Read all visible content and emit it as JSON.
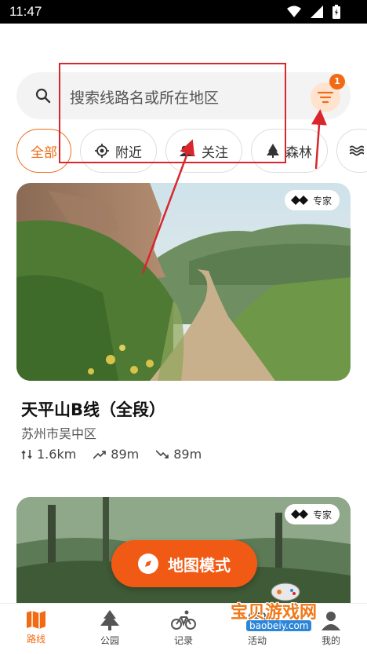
{
  "status": {
    "time": "11:47"
  },
  "search": {
    "placeholder": "搜索线路名或所在地区",
    "filter_badge": "1"
  },
  "chips": [
    {
      "label": "全部",
      "active": true,
      "icon": "none"
    },
    {
      "label": "附近",
      "icon": "location-target-icon"
    },
    {
      "label": "关注",
      "icon": "people-icon"
    },
    {
      "label": "森林",
      "icon": "tree-icon"
    },
    {
      "label": "",
      "icon": "water-waves-icon"
    }
  ],
  "cards": [
    {
      "badge": "专家",
      "title": "天平山B线（全段）",
      "location": "苏州市吴中区",
      "distance": "1.6km",
      "ascent": "89m",
      "descent": "89m"
    },
    {
      "badge": "专家"
    }
  ],
  "fab": {
    "label": "地图模式"
  },
  "tabs": [
    {
      "label": "路线",
      "icon": "map-icon",
      "active": true
    },
    {
      "label": "公园",
      "icon": "tree-icon"
    },
    {
      "label": "记录",
      "icon": "bicycle-icon"
    },
    {
      "label": "活动",
      "icon": "activity-icon"
    },
    {
      "label": "我的",
      "icon": "profile-icon"
    }
  ],
  "watermark": {
    "text": "宝贝游戏网",
    "url": "baobeiy.com"
  },
  "colors": {
    "accent": "#f06b14",
    "annotation": "#d9262c"
  }
}
